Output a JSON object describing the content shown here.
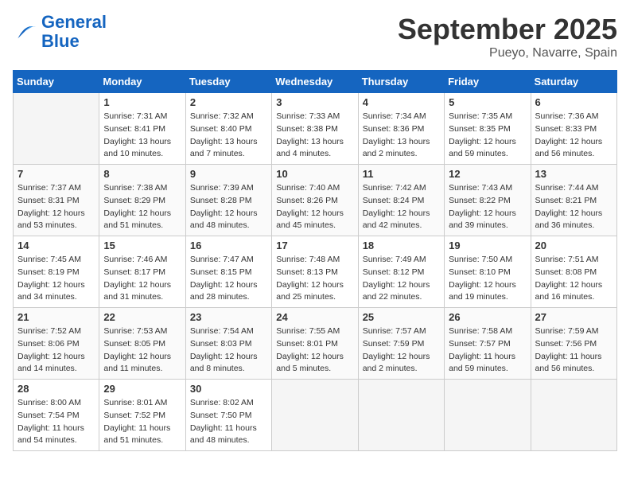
{
  "header": {
    "logo_general": "General",
    "logo_blue": "Blue",
    "month": "September 2025",
    "location": "Pueyo, Navarre, Spain"
  },
  "days_of_week": [
    "Sunday",
    "Monday",
    "Tuesday",
    "Wednesday",
    "Thursday",
    "Friday",
    "Saturday"
  ],
  "weeks": [
    [
      {
        "day": "",
        "sunrise": "",
        "sunset": "",
        "daylight": ""
      },
      {
        "day": "1",
        "sunrise": "Sunrise: 7:31 AM",
        "sunset": "Sunset: 8:41 PM",
        "daylight": "Daylight: 13 hours and 10 minutes."
      },
      {
        "day": "2",
        "sunrise": "Sunrise: 7:32 AM",
        "sunset": "Sunset: 8:40 PM",
        "daylight": "Daylight: 13 hours and 7 minutes."
      },
      {
        "day": "3",
        "sunrise": "Sunrise: 7:33 AM",
        "sunset": "Sunset: 8:38 PM",
        "daylight": "Daylight: 13 hours and 4 minutes."
      },
      {
        "day": "4",
        "sunrise": "Sunrise: 7:34 AM",
        "sunset": "Sunset: 8:36 PM",
        "daylight": "Daylight: 13 hours and 2 minutes."
      },
      {
        "day": "5",
        "sunrise": "Sunrise: 7:35 AM",
        "sunset": "Sunset: 8:35 PM",
        "daylight": "Daylight: 12 hours and 59 minutes."
      },
      {
        "day": "6",
        "sunrise": "Sunrise: 7:36 AM",
        "sunset": "Sunset: 8:33 PM",
        "daylight": "Daylight: 12 hours and 56 minutes."
      }
    ],
    [
      {
        "day": "7",
        "sunrise": "Sunrise: 7:37 AM",
        "sunset": "Sunset: 8:31 PM",
        "daylight": "Daylight: 12 hours and 53 minutes."
      },
      {
        "day": "8",
        "sunrise": "Sunrise: 7:38 AM",
        "sunset": "Sunset: 8:29 PM",
        "daylight": "Daylight: 12 hours and 51 minutes."
      },
      {
        "day": "9",
        "sunrise": "Sunrise: 7:39 AM",
        "sunset": "Sunset: 8:28 PM",
        "daylight": "Daylight: 12 hours and 48 minutes."
      },
      {
        "day": "10",
        "sunrise": "Sunrise: 7:40 AM",
        "sunset": "Sunset: 8:26 PM",
        "daylight": "Daylight: 12 hours and 45 minutes."
      },
      {
        "day": "11",
        "sunrise": "Sunrise: 7:42 AM",
        "sunset": "Sunset: 8:24 PM",
        "daylight": "Daylight: 12 hours and 42 minutes."
      },
      {
        "day": "12",
        "sunrise": "Sunrise: 7:43 AM",
        "sunset": "Sunset: 8:22 PM",
        "daylight": "Daylight: 12 hours and 39 minutes."
      },
      {
        "day": "13",
        "sunrise": "Sunrise: 7:44 AM",
        "sunset": "Sunset: 8:21 PM",
        "daylight": "Daylight: 12 hours and 36 minutes."
      }
    ],
    [
      {
        "day": "14",
        "sunrise": "Sunrise: 7:45 AM",
        "sunset": "Sunset: 8:19 PM",
        "daylight": "Daylight: 12 hours and 34 minutes."
      },
      {
        "day": "15",
        "sunrise": "Sunrise: 7:46 AM",
        "sunset": "Sunset: 8:17 PM",
        "daylight": "Daylight: 12 hours and 31 minutes."
      },
      {
        "day": "16",
        "sunrise": "Sunrise: 7:47 AM",
        "sunset": "Sunset: 8:15 PM",
        "daylight": "Daylight: 12 hours and 28 minutes."
      },
      {
        "day": "17",
        "sunrise": "Sunrise: 7:48 AM",
        "sunset": "Sunset: 8:13 PM",
        "daylight": "Daylight: 12 hours and 25 minutes."
      },
      {
        "day": "18",
        "sunrise": "Sunrise: 7:49 AM",
        "sunset": "Sunset: 8:12 PM",
        "daylight": "Daylight: 12 hours and 22 minutes."
      },
      {
        "day": "19",
        "sunrise": "Sunrise: 7:50 AM",
        "sunset": "Sunset: 8:10 PM",
        "daylight": "Daylight: 12 hours and 19 minutes."
      },
      {
        "day": "20",
        "sunrise": "Sunrise: 7:51 AM",
        "sunset": "Sunset: 8:08 PM",
        "daylight": "Daylight: 12 hours and 16 minutes."
      }
    ],
    [
      {
        "day": "21",
        "sunrise": "Sunrise: 7:52 AM",
        "sunset": "Sunset: 8:06 PM",
        "daylight": "Daylight: 12 hours and 14 minutes."
      },
      {
        "day": "22",
        "sunrise": "Sunrise: 7:53 AM",
        "sunset": "Sunset: 8:05 PM",
        "daylight": "Daylight: 12 hours and 11 minutes."
      },
      {
        "day": "23",
        "sunrise": "Sunrise: 7:54 AM",
        "sunset": "Sunset: 8:03 PM",
        "daylight": "Daylight: 12 hours and 8 minutes."
      },
      {
        "day": "24",
        "sunrise": "Sunrise: 7:55 AM",
        "sunset": "Sunset: 8:01 PM",
        "daylight": "Daylight: 12 hours and 5 minutes."
      },
      {
        "day": "25",
        "sunrise": "Sunrise: 7:57 AM",
        "sunset": "Sunset: 7:59 PM",
        "daylight": "Daylight: 12 hours and 2 minutes."
      },
      {
        "day": "26",
        "sunrise": "Sunrise: 7:58 AM",
        "sunset": "Sunset: 7:57 PM",
        "daylight": "Daylight: 11 hours and 59 minutes."
      },
      {
        "day": "27",
        "sunrise": "Sunrise: 7:59 AM",
        "sunset": "Sunset: 7:56 PM",
        "daylight": "Daylight: 11 hours and 56 minutes."
      }
    ],
    [
      {
        "day": "28",
        "sunrise": "Sunrise: 8:00 AM",
        "sunset": "Sunset: 7:54 PM",
        "daylight": "Daylight: 11 hours and 54 minutes."
      },
      {
        "day": "29",
        "sunrise": "Sunrise: 8:01 AM",
        "sunset": "Sunset: 7:52 PM",
        "daylight": "Daylight: 11 hours and 51 minutes."
      },
      {
        "day": "30",
        "sunrise": "Sunrise: 8:02 AM",
        "sunset": "Sunset: 7:50 PM",
        "daylight": "Daylight: 11 hours and 48 minutes."
      },
      {
        "day": "",
        "sunrise": "",
        "sunset": "",
        "daylight": ""
      },
      {
        "day": "",
        "sunrise": "",
        "sunset": "",
        "daylight": ""
      },
      {
        "day": "",
        "sunrise": "",
        "sunset": "",
        "daylight": ""
      },
      {
        "day": "",
        "sunrise": "",
        "sunset": "",
        "daylight": ""
      }
    ]
  ]
}
